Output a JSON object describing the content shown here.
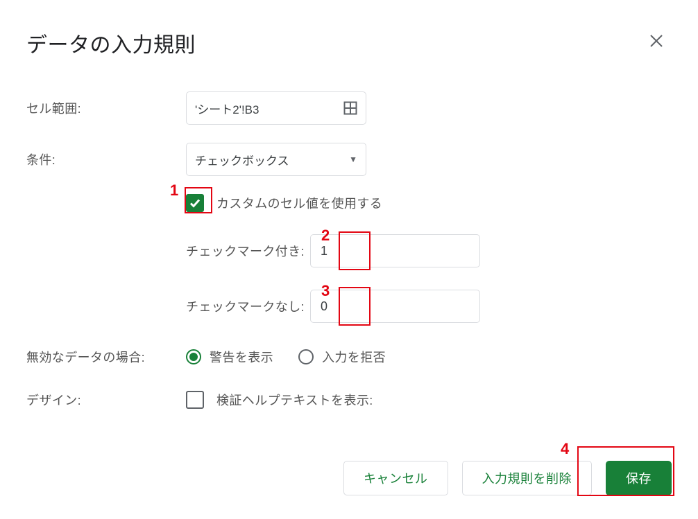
{
  "dialog": {
    "title": "データの入力規則",
    "labels": {
      "cell_range": "セル範囲:",
      "condition": "条件:",
      "on_invalid": "無効なデータの場合:",
      "design": "デザイン:"
    },
    "cell_range_value": "'シート2'!B3",
    "condition_value": "チェックボックス",
    "custom_values": {
      "use_custom_label": "カスタムのセル値を使用する",
      "checked_label": "チェックマーク付き:",
      "checked_value": "1",
      "unchecked_label": "チェックマークなし:",
      "unchecked_value": "0"
    },
    "invalid_options": {
      "show_warning": "警告を表示",
      "reject_input": "入力を拒否"
    },
    "design_option_label": "検証ヘルプテキストを表示:",
    "buttons": {
      "cancel": "キャンセル",
      "remove": "入力規則を削除",
      "save": "保存"
    }
  },
  "annotations": {
    "n1": "1",
    "n2": "2",
    "n3": "3",
    "n4": "4"
  }
}
